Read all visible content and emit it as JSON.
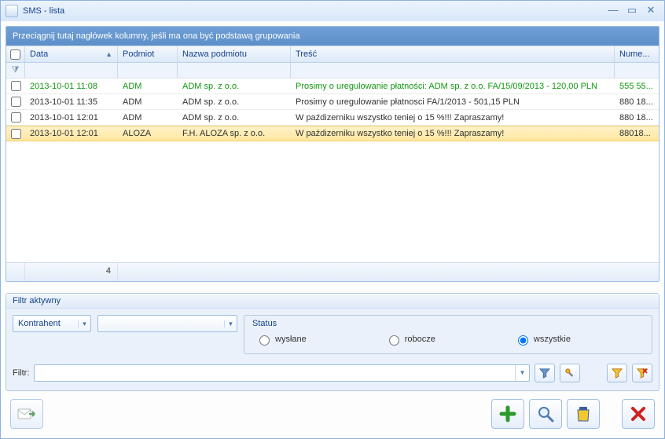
{
  "window": {
    "title": "SMS - lista"
  },
  "groupbar": "Przeciągnij tutaj nagłówek kolumny, jeśli ma ona być podstawą grupowania",
  "columns": {
    "data": "Data",
    "podmiot": "Podmiot",
    "nazwa": "Nazwa podmiotu",
    "tresc": "Treść",
    "numer": "Nume..."
  },
  "rows": [
    {
      "data": "2013-10-01 11:08",
      "pod": "ADM",
      "naz": "ADM sp. z o.o.",
      "tresc": "Prosimy o uregulowanie płatności: ADM sp. z o.o. FA/15/09/2013  - 120,00 PLN",
      "num": "555 55...",
      "green": true,
      "sel": false
    },
    {
      "data": "2013-10-01 11:35",
      "pod": "ADM",
      "naz": "ADM sp. z o.o.",
      "tresc": "Prosimy o uregulowanie płatnosci FA/1/2013 - 501,15 PLN",
      "num": "880 18...",
      "green": false,
      "sel": false
    },
    {
      "data": "2013-10-01 12:01",
      "pod": "ADM",
      "naz": "ADM sp. z o.o.",
      "tresc": "W paźdizerniku wszystko teniej o 15 %!!! Zapraszamy!",
      "num": "880 18...",
      "green": false,
      "sel": false
    },
    {
      "data": "2013-10-01 12:01",
      "pod": "ALOZA",
      "naz": "F.H. ALOZA sp. z o.o.",
      "tresc": "W paźdizerniku wszystko teniej o 15 %!!! Zapraszamy!",
      "num": "88018...",
      "green": false,
      "sel": true
    }
  ],
  "rowcount": "4",
  "filter": {
    "panel_title": "Filtr aktywny",
    "field": "Kontrahent",
    "value": "",
    "status_label": "Status",
    "status_options": {
      "wyslane": "wysłane",
      "robocze": "robocze",
      "wszystkie": "wszystkie"
    },
    "label": "Filtr:"
  }
}
